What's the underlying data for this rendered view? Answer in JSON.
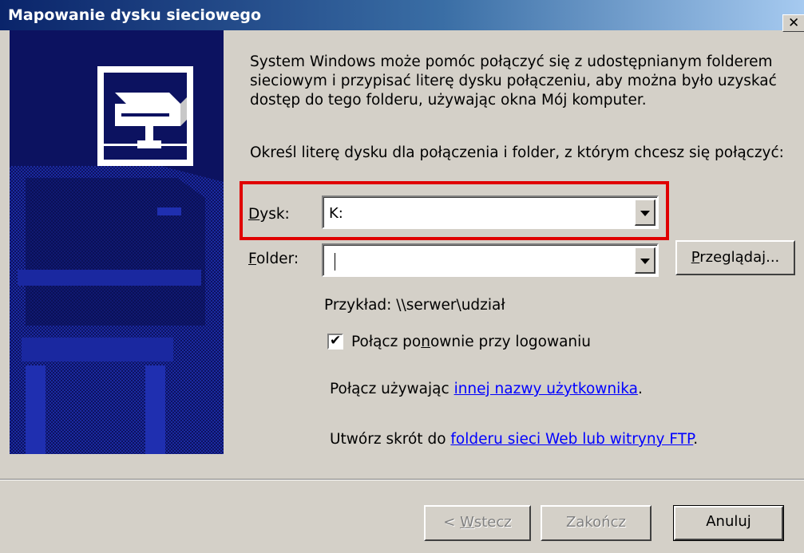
{
  "window": {
    "title": "Mapowanie dysku sieciowego",
    "close_glyph": "✕"
  },
  "intro": {
    "line1": "System Windows może pomóc połączyć się z udostępnianym folderem",
    "line2": "sieciowym i przypisać literę dysku połączeniu, aby można było uzyskać",
    "line3": "dostęp do tego folderu, używając okna Mój komputer."
  },
  "instruction": "Określ literę dysku dla połączenia i folder, z którym chcesz się połączyć:",
  "drive": {
    "label_accel": "D",
    "label_rest": "ysk:",
    "value": "K:"
  },
  "folder": {
    "label_accel": "F",
    "label_rest": "older:",
    "value": ""
  },
  "browse": {
    "label_accel": "P",
    "label_rest": "rzeglądaj..."
  },
  "example": "Przykład: \\\\serwer\\udział",
  "reconnect": {
    "checked": true,
    "text_before": "Połącz po",
    "accel": "n",
    "text_after": "ownie przy logowaniu"
  },
  "other_user": {
    "text": "Połącz używając ",
    "link": "innej nazwy użytkownika",
    "suffix": "."
  },
  "shortcut": {
    "text": "Utwórz skrót do ",
    "link": "folderu sieci Web lub witryny FTP",
    "suffix": "."
  },
  "buttons": {
    "back": {
      "prefix": "< ",
      "accel": "W",
      "rest": "stecz"
    },
    "finish": "Zakończ",
    "cancel": "Anuluj"
  },
  "colors": {
    "highlight": "#e00000",
    "side_panel": "#0c1260",
    "link": "#0000ff"
  }
}
